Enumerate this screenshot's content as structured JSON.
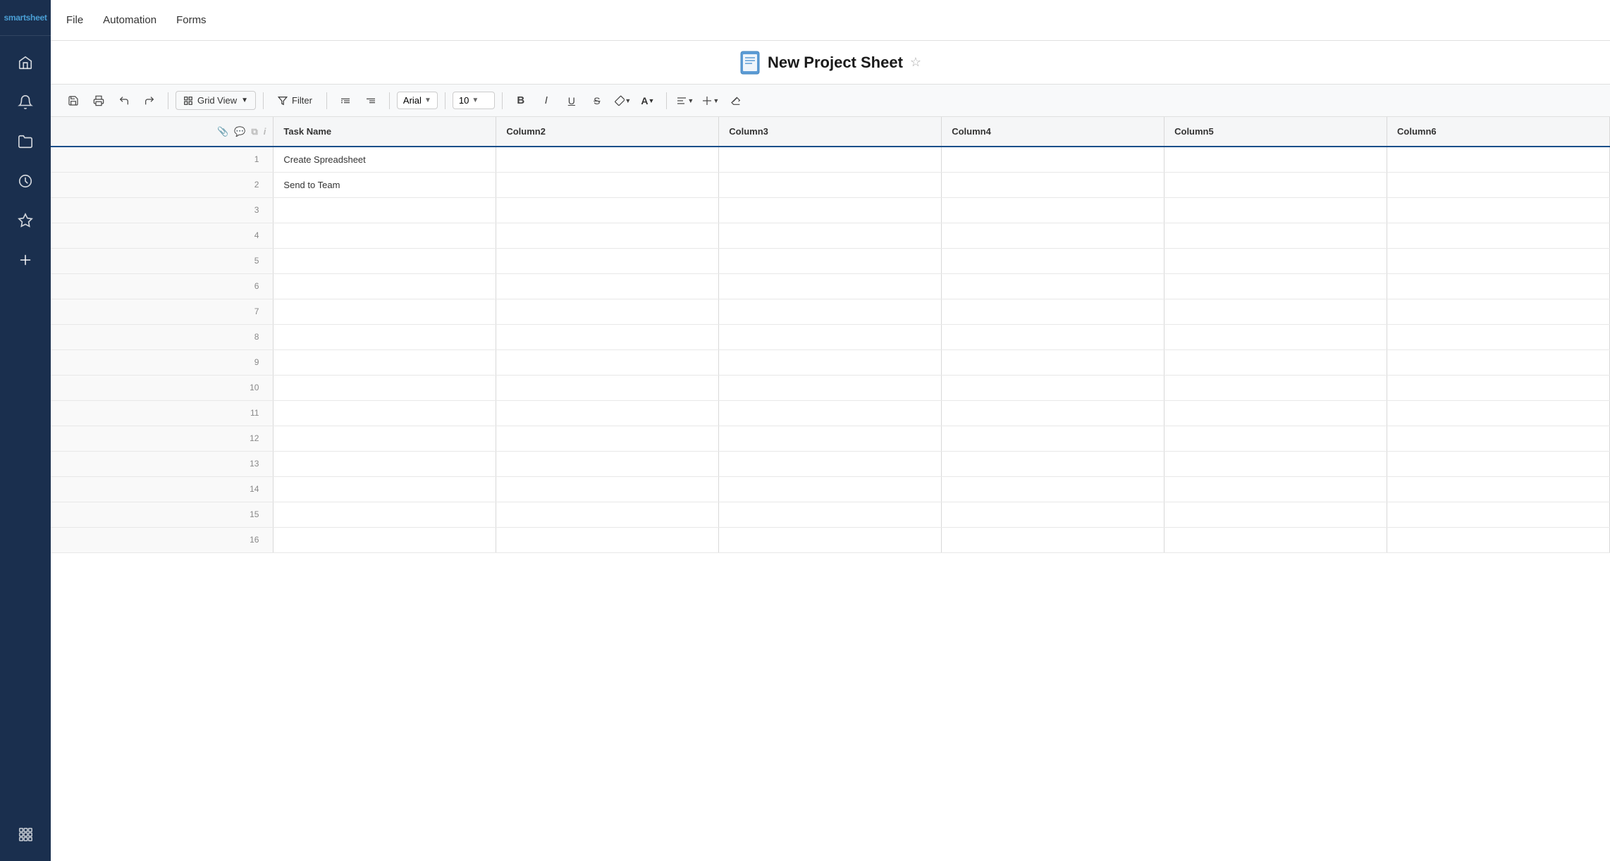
{
  "brand": {
    "name": "smartsheet"
  },
  "sidebar": {
    "items": [
      {
        "id": "home",
        "label": "Home",
        "icon": "home"
      },
      {
        "id": "notifications",
        "label": "Notifications",
        "icon": "bell"
      },
      {
        "id": "folders",
        "label": "Folders",
        "icon": "folder"
      },
      {
        "id": "recent",
        "label": "Recent",
        "icon": "clock"
      },
      {
        "id": "favorites",
        "label": "Favorites",
        "icon": "star"
      },
      {
        "id": "add",
        "label": "Add",
        "icon": "plus"
      }
    ],
    "bottom": [
      {
        "id": "apps",
        "label": "Apps",
        "icon": "grid"
      }
    ]
  },
  "header": {
    "menu": [
      "File",
      "Automation",
      "Forms"
    ]
  },
  "titlebar": {
    "sheet_title": "New Project Sheet",
    "sheet_icon_color": "#5b9bd5"
  },
  "toolbar": {
    "view_label": "Grid View",
    "filter_label": "Filter",
    "font_family": "Arial",
    "font_size": "10",
    "bold_label": "B",
    "italic_label": "I",
    "underline_label": "U",
    "strike_label": "S"
  },
  "grid": {
    "columns": [
      {
        "id": "task_name",
        "label": "Task Name"
      },
      {
        "id": "col2",
        "label": "Column2"
      },
      {
        "id": "col3",
        "label": "Column3"
      },
      {
        "id": "col4",
        "label": "Column4"
      },
      {
        "id": "col5",
        "label": "Column5"
      },
      {
        "id": "col6",
        "label": "Column6"
      }
    ],
    "rows": [
      {
        "num": 1,
        "task_name": "Create Spreadsheet",
        "col2": "",
        "col3": "",
        "col4": "",
        "col5": "",
        "col6": ""
      },
      {
        "num": 2,
        "task_name": "Send to Team",
        "col2": "",
        "col3": "",
        "col4": "",
        "col5": "",
        "col6": ""
      },
      {
        "num": 3,
        "task_name": "",
        "col2": "",
        "col3": "",
        "col4": "",
        "col5": "",
        "col6": ""
      },
      {
        "num": 4,
        "task_name": "",
        "col2": "",
        "col3": "",
        "col4": "",
        "col5": "",
        "col6": ""
      },
      {
        "num": 5,
        "task_name": "",
        "col2": "",
        "col3": "",
        "col4": "",
        "col5": "",
        "col6": ""
      },
      {
        "num": 6,
        "task_name": "",
        "col2": "",
        "col3": "",
        "col4": "",
        "col5": "",
        "col6": ""
      },
      {
        "num": 7,
        "task_name": "",
        "col2": "",
        "col3": "",
        "col4": "",
        "col5": "",
        "col6": ""
      },
      {
        "num": 8,
        "task_name": "",
        "col2": "",
        "col3": "",
        "col4": "",
        "col5": "",
        "col6": ""
      },
      {
        "num": 9,
        "task_name": "",
        "col2": "",
        "col3": "",
        "col4": "",
        "col5": "",
        "col6": ""
      },
      {
        "num": 10,
        "task_name": "",
        "col2": "",
        "col3": "",
        "col4": "",
        "col5": "",
        "col6": ""
      },
      {
        "num": 11,
        "task_name": "",
        "col2": "",
        "col3": "",
        "col4": "",
        "col5": "",
        "col6": ""
      },
      {
        "num": 12,
        "task_name": "",
        "col2": "",
        "col3": "",
        "col4": "",
        "col5": "",
        "col6": ""
      },
      {
        "num": 13,
        "task_name": "",
        "col2": "",
        "col3": "",
        "col4": "",
        "col5": "",
        "col6": ""
      },
      {
        "num": 14,
        "task_name": "",
        "col2": "",
        "col3": "",
        "col4": "",
        "col5": "",
        "col6": ""
      },
      {
        "num": 15,
        "task_name": "",
        "col2": "",
        "col3": "",
        "col4": "",
        "col5": "",
        "col6": ""
      },
      {
        "num": 16,
        "task_name": "",
        "col2": "",
        "col3": "",
        "col4": "",
        "col5": "",
        "col6": ""
      }
    ]
  }
}
